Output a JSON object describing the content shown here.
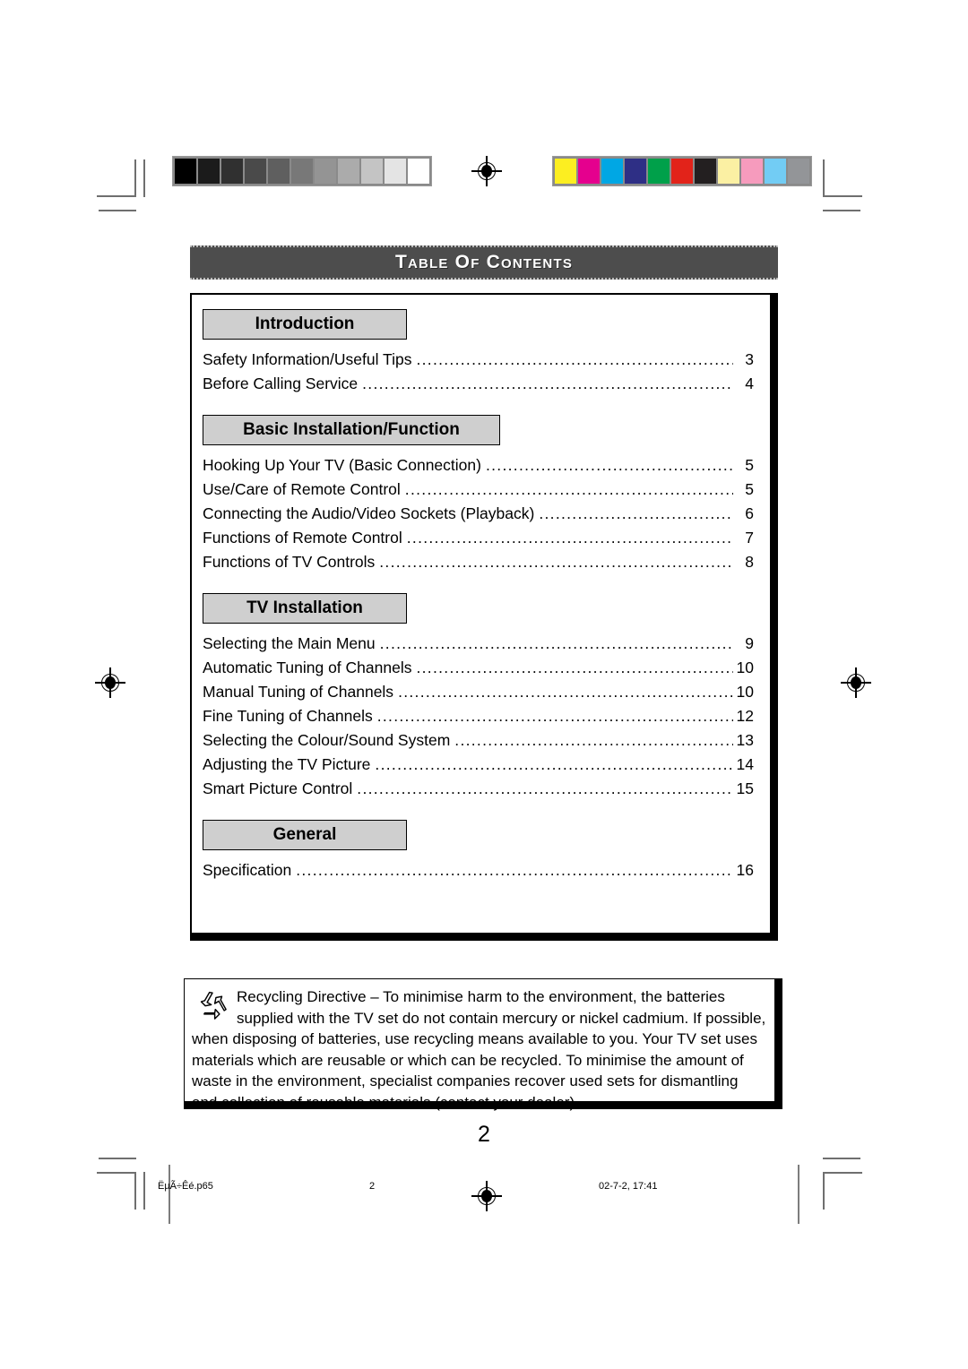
{
  "document": {
    "banner_title": "Table Of Contents",
    "page_number": "2"
  },
  "calibration": {
    "grayscale_label": "grayscale-calibration-strip",
    "grayscale_swatches": [
      "#000000",
      "#1b1b1b",
      "#303030",
      "#4a4a4a",
      "#5f5f5f",
      "#787878",
      "#949494",
      "#ababab",
      "#c4c4c4",
      "#e4e4e4",
      "#ffffff"
    ],
    "color_label": "color-calibration-strip",
    "color_swatches": [
      "#fcee21",
      "#e5008e",
      "#00a7e4",
      "#2e2f85",
      "#00a04a",
      "#e2231a",
      "#231f20",
      "#fbf0a3",
      "#f69bbd",
      "#72ccf4",
      "#939598"
    ]
  },
  "sections": [
    {
      "id": "introduction",
      "heading": "Introduction",
      "width": "narrow",
      "entries": [
        {
          "label": "Safety Information/Useful Tips",
          "page": "3"
        },
        {
          "label": "Before  Calling Service",
          "page": "4"
        }
      ]
    },
    {
      "id": "basic-installation-function",
      "heading": "Basic Installation/Function",
      "width": "wide",
      "entries": [
        {
          "label": "Hooking Up Your TV (Basic Connection)",
          "page": "5"
        },
        {
          "label": "Use/Care of Remote Control",
          "page": "5"
        },
        {
          "label": "Connecting the Audio/Video Sockets (Playback)",
          "page": "6"
        },
        {
          "label": "Functions of Remote Control",
          "page": "7"
        },
        {
          "label": "Functions of TV Controls",
          "page": "8"
        }
      ]
    },
    {
      "id": "tv-installation",
      "heading": "TV Installation",
      "width": "narrow",
      "entries": [
        {
          "label": "Selecting the Main Menu",
          "page": "9"
        },
        {
          "label": "Automatic Tuning of Channels",
          "page": "10"
        },
        {
          "label": "Manual Tuning of Channels",
          "page": "10"
        },
        {
          "label": "Fine Tuning of Channels",
          "page": "12"
        },
        {
          "label": "Selecting the Colour/Sound System",
          "page": "13"
        },
        {
          "label": "Adjusting the TV Picture",
          "page": "14"
        },
        {
          "label": "Smart Picture Control",
          "page": "15"
        }
      ]
    },
    {
      "id": "general",
      "heading": "General",
      "width": "narrow",
      "entries": [
        {
          "label": "Specification",
          "page": "16"
        }
      ]
    }
  ],
  "notice": {
    "icon": "recycling-icon",
    "text": "Recycling Directive – To minimise harm to the environment, the batteries supplied with the TV set do not contain mercury or nickel cadmium.  If possible, when disposing of batteries, use recycling means available to you. Your TV set uses materials which are reusable or which can be recycled. To minimise the amount of waste in the environment, specialist companies recover used sets for dismantling and collection of reusable materials (contact your dealer)."
  },
  "print_footer": {
    "filename": "ËµÃ÷Êé.p65",
    "sheet_number": "2",
    "timestamp": "02-7-2, 17:41"
  }
}
